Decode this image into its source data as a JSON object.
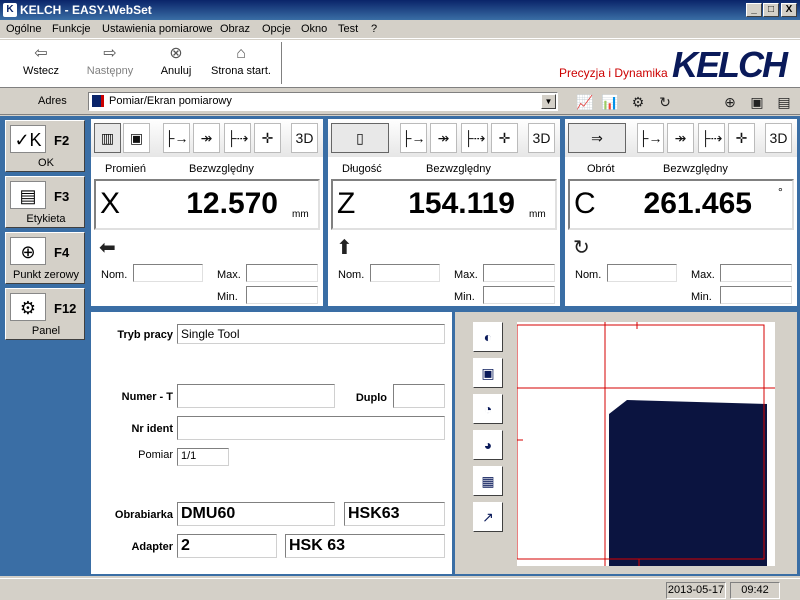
{
  "window": {
    "title": "KELCH - EASY-WebSet",
    "app_icon": "K",
    "minimize": "_",
    "maximize": "□",
    "close": "X"
  },
  "menu": [
    "Ogólne",
    "Funkcje",
    "Ustawienia pomiarowe",
    "Obraz",
    "Opcje",
    "Okno",
    "Test",
    "?"
  ],
  "toolbar": {
    "back": "Wstecz",
    "back_icon": "⇦",
    "next": "Następny",
    "next_icon": "⇨",
    "cancel": "Anuluj",
    "cancel_icon": "⊗",
    "home": "Strona start.",
    "home_icon": "⌂",
    "tagline": "Precyzja i Dynamika",
    "logo": "KELCH"
  },
  "address": {
    "label": "Adres",
    "value": "Pomiar/Ekran pomiarowy",
    "dropdown": "▼"
  },
  "address_icons": [
    "📈",
    "📊",
    "⚙",
    "↻",
    "⊕",
    "▣",
    "▤"
  ],
  "fkeys": [
    {
      "key": "F2",
      "label": "OK",
      "icon": "✓K"
    },
    {
      "key": "F3",
      "label": "Etykieta",
      "icon": "▤"
    },
    {
      "key": "F4",
      "label": "Punkt zerowy",
      "icon": "⊕"
    },
    {
      "key": "F12",
      "label": "Panel",
      "icon": "⚙"
    }
  ],
  "axes": [
    {
      "mode": "Promień",
      "ref": "Bezwzględny",
      "letter": "X",
      "value": "12.570",
      "unit": "mm",
      "arrow": "⬅",
      "nom": "Nom.",
      "max": "Max.",
      "min": "Min."
    },
    {
      "mode": "Długość",
      "ref": "Bezwzględny",
      "letter": "Z",
      "value": "154.119",
      "unit": "mm",
      "arrow": "⬆",
      "nom": "Nom.",
      "max": "Max.",
      "min": "Min."
    },
    {
      "mode": "Obrót",
      "ref": "Bezwzględny",
      "letter": "C",
      "value": "261.465",
      "unit": "°",
      "arrow": "↻",
      "nom": "Nom.",
      "max": "Max.",
      "min": "Min."
    }
  ],
  "axis_icons": {
    "tool1": "▥",
    "tool2": "▣",
    "len": "▯",
    "rot": "⇒",
    "m1": "├→",
    "m2": "↠",
    "m3": "├⇢",
    "m4": "✛",
    "op": "3D"
  },
  "form": {
    "mode_label": "Tryb pracy",
    "mode_value": "Single Tool",
    "t_label": "Numer - T",
    "t_value": "",
    "duplo_label": "Duplo",
    "duplo_value": "",
    "ident_label": "Nr ident",
    "ident_value": "",
    "pomiar_label": "Pomiar",
    "pomiar_value": "1/1",
    "machine_label": "Obrabiarka",
    "machine_value": "DMU60",
    "machine_spindle": "HSK63",
    "adapter_label": "Adapter",
    "adapter_value": "2",
    "adapter_spindle": "HSK 63"
  },
  "view_buttons": [
    "◐",
    "▣",
    "◔",
    "◕",
    "▦",
    "↗"
  ],
  "status": {
    "date": "2013-05-17",
    "time": "09:42"
  },
  "colors": {
    "accent": "#3a6ea5",
    "tool": "#0b1440",
    "line": "#d40000"
  }
}
